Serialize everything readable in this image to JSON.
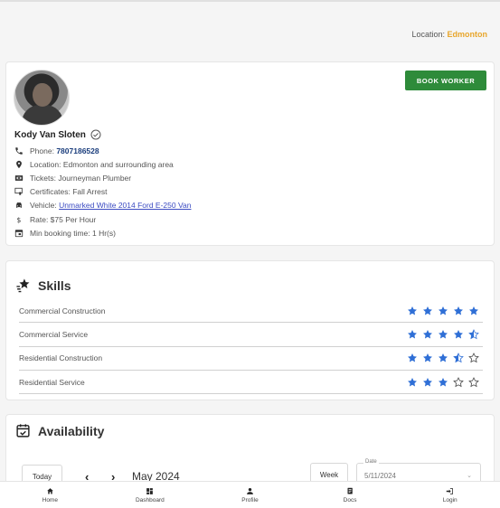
{
  "header": {
    "location_label": "Location:",
    "location_value": "Edmonton"
  },
  "profile": {
    "book_label": "BOOK WORKER",
    "name": "Kody Van Sloten",
    "phone_label": "Phone:",
    "phone_value": "7807186528",
    "location": "Location: Edmonton and surrounding area",
    "tickets": "Tickets: Journeyman Plumber",
    "certificates": "Certificates: Fall Arrest",
    "vehicle_label": "Vehicle:",
    "vehicle_value": "Unmarked White 2014 Ford E-250 Van",
    "rate": "Rate: $75 Per Hour",
    "min_booking": "Min booking time: 1 Hr(s)"
  },
  "skills": {
    "title": "Skills",
    "items": [
      {
        "name": "Commercial Construction",
        "rating": 5
      },
      {
        "name": "Commercial Service",
        "rating": 4.5
      },
      {
        "name": "Residential Construction",
        "rating": 3.5
      },
      {
        "name": "Residential Service",
        "rating": 3
      }
    ],
    "max_rating": 5,
    "star_color": "#2f6fd6"
  },
  "availability": {
    "title": "Availability",
    "today_label": "Today",
    "prev_icon": "chevron-left-icon",
    "next_icon": "chevron-right-icon",
    "month": "May 2024",
    "view_label": "Week",
    "date_label": "Date",
    "date_value": "5/11/2024"
  },
  "bottom_nav": [
    {
      "label": "Home",
      "icon": "home-icon"
    },
    {
      "label": "Dashboard",
      "icon": "dashboard-icon"
    },
    {
      "label": "Profile",
      "icon": "person-icon"
    },
    {
      "label": "Docs",
      "icon": "docs-icon"
    },
    {
      "label": "Login",
      "icon": "login-icon"
    }
  ],
  "colors": {
    "accent_green": "#2e8b3a",
    "location_gold": "#e8a62c",
    "link_blue": "#3b4bc2"
  }
}
